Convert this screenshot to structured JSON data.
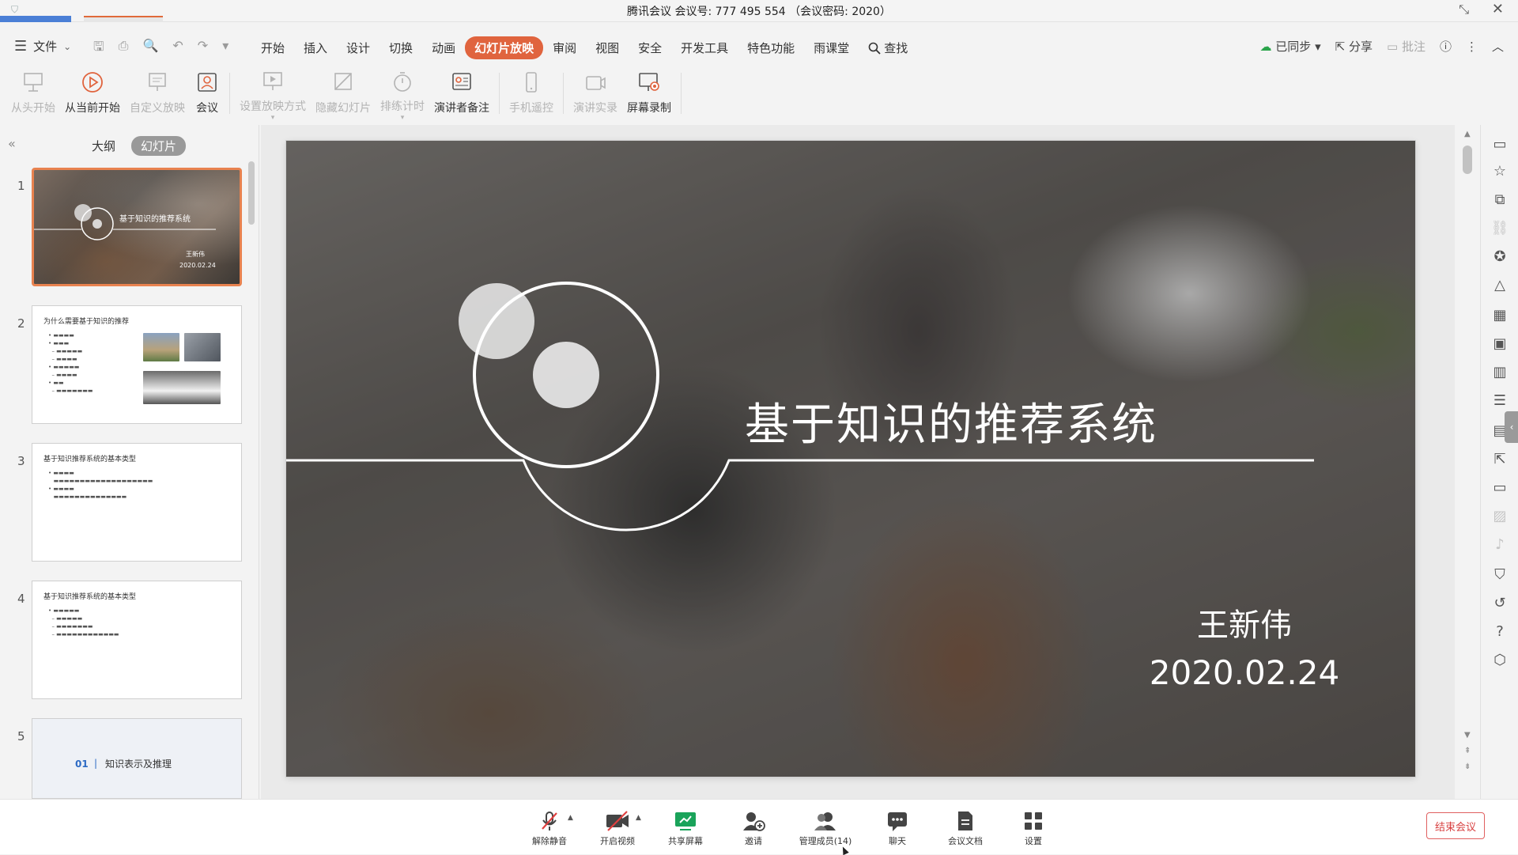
{
  "titlebar": {
    "meeting_title": "腾讯会议 会议号: 777 495 554 （会议密码: 2020）"
  },
  "menu": {
    "file_label": "文件",
    "tabs": [
      "开始",
      "插入",
      "设计",
      "切换",
      "动画",
      "幻灯片放映",
      "审阅",
      "视图",
      "安全",
      "开发工具",
      "特色功能",
      "雨课堂"
    ],
    "active_tab": "幻灯片放映",
    "search_label": "查找",
    "synced_label": "已同步",
    "share_label": "分享",
    "comment_label": "批注"
  },
  "ribbon": {
    "items": [
      {
        "label": "从头开始",
        "enabled": false,
        "icon": "projector-icon"
      },
      {
        "label": "从当前开始",
        "enabled": true,
        "icon": "play-icon"
      },
      {
        "label": "自定义放映",
        "enabled": false,
        "icon": "custom-show-icon"
      },
      {
        "label": "会议",
        "enabled": true,
        "icon": "meeting-icon"
      },
      {
        "label": "设置放映方式",
        "enabled": false,
        "icon": "show-settings-icon"
      },
      {
        "label": "隐藏幻灯片",
        "enabled": false,
        "icon": "hide-slide-icon"
      },
      {
        "label": "排练计时",
        "enabled": false,
        "icon": "timer-icon"
      },
      {
        "label": "演讲者备注",
        "enabled": true,
        "icon": "speaker-notes-icon"
      },
      {
        "label": "手机遥控",
        "enabled": false,
        "icon": "phone-remote-icon"
      },
      {
        "label": "演讲实录",
        "enabled": false,
        "icon": "record-talk-icon"
      },
      {
        "label": "屏幕录制",
        "enabled": true,
        "icon": "screen-record-icon"
      }
    ]
  },
  "left_panel": {
    "view_outline": "大纲",
    "view_slides": "幻灯片",
    "thumbnails": [
      {
        "num": "1",
        "title": "基于知识的推荐系统",
        "author": "王新伟",
        "date": "2020.02.24"
      },
      {
        "num": "2",
        "title": "为什么需要基于知识的推荐"
      },
      {
        "num": "3",
        "title": "基于知识推荐系统的基本类型"
      },
      {
        "num": "4",
        "title": "基于知识推荐系统的基本类型"
      },
      {
        "num": "5",
        "section_num": "01",
        "section_title": "知识表示及推理"
      }
    ]
  },
  "slide": {
    "title": "基于知识的推荐系统",
    "author": "王新伟",
    "date": "2020.02.24"
  },
  "meeting_bar": {
    "items": [
      {
        "label": "解除静音",
        "icon": "mic-muted-icon"
      },
      {
        "label": "开启视频",
        "icon": "video-off-icon"
      },
      {
        "label": "共享屏幕",
        "icon": "share-screen-icon"
      },
      {
        "label": "邀请",
        "icon": "invite-icon"
      },
      {
        "label": "管理成员(14)",
        "icon": "members-icon"
      },
      {
        "label": "聊天",
        "icon": "chat-icon"
      },
      {
        "label": "会议文档",
        "icon": "document-icon"
      },
      {
        "label": "设置",
        "icon": "settings-icon"
      }
    ],
    "end_label": "结束会议"
  },
  "colors": {
    "accent": "#e0643e",
    "selected_thumb_border": "#e8824f",
    "end_button": "#d84040",
    "share_screen_green": "#1aa35a"
  }
}
